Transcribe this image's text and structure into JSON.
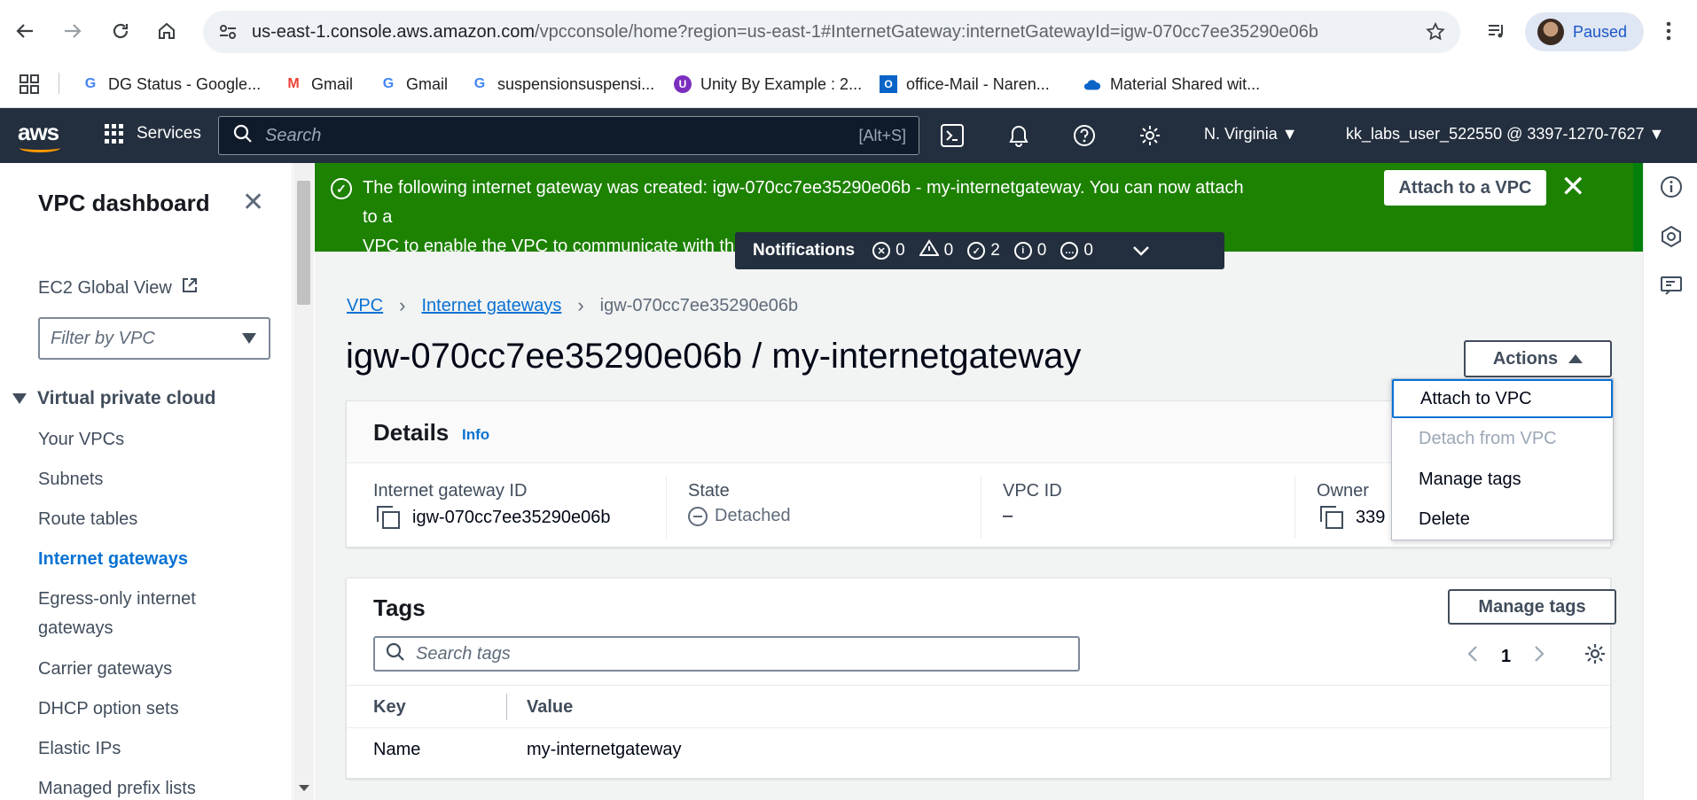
{
  "browser": {
    "url_host": "us-east-1.console.aws.amazon.com",
    "url_path": "/vpcconsole/home?region=us-east-1#InternetGateway:internetGatewayId=igw-070cc7ee35290e06b",
    "profile_status": "Paused"
  },
  "bookmarks": [
    {
      "label": "DG Status - Google...",
      "icon": "google-icon"
    },
    {
      "label": "Gmail",
      "icon": "gmail-icon"
    },
    {
      "label": "Gmail",
      "icon": "google-icon"
    },
    {
      "label": "suspensionsuspensi...",
      "icon": "google-icon"
    },
    {
      "label": "Unity By Example : 2...",
      "icon": "unity-icon"
    },
    {
      "label": "office-Mail - Naren...",
      "icon": "outlook-icon"
    },
    {
      "label": "Material Shared wit...",
      "icon": "onedrive-icon"
    }
  ],
  "aws_nav": {
    "logo": "aws",
    "services": "Services",
    "search_placeholder": "Search",
    "search_shortcut": "[Alt+S]",
    "region": "N. Virginia",
    "account": "kk_labs_user_522550 @ 3397-1270-7627"
  },
  "sidebar": {
    "title": "VPC dashboard",
    "ec2_global": "EC2 Global View",
    "filter_placeholder": "Filter by VPC",
    "section": "Virtual private cloud",
    "items": [
      {
        "label": "Your VPCs",
        "active": false
      },
      {
        "label": "Subnets",
        "active": false
      },
      {
        "label": "Route tables",
        "active": false
      },
      {
        "label": "Internet gateways",
        "active": true
      },
      {
        "label": "Egress-only internet",
        "active": false
      },
      {
        "label": "gateways",
        "active": false
      },
      {
        "label": "Carrier gateways",
        "active": false
      },
      {
        "label": "DHCP option sets",
        "active": false
      },
      {
        "label": "Elastic IPs",
        "active": false
      },
      {
        "label": "Managed prefix lists",
        "active": false
      }
    ]
  },
  "flash": {
    "line1": "The following internet gateway was created: igw-070cc7ee35290e06b - my-internetgateway. You can now attach to a",
    "line2": "VPC to enable the VPC to communicate with the internet.",
    "button": "Attach to a VPC",
    "color": "#1d8102"
  },
  "notifications": {
    "label": "Notifications",
    "errors": "0",
    "warnings": "0",
    "success": "2",
    "info": "0",
    "in_progress": "0"
  },
  "breadcrumb": {
    "vpc": "VPC",
    "igw": "Internet gateways",
    "current": "igw-070cc7ee35290e06b"
  },
  "page_title": "igw-070cc7ee35290e06b / my-internetgateway",
  "actions": {
    "label": "Actions",
    "menu": [
      "Attach to VPC",
      "Detach from VPC",
      "Manage tags",
      "Delete"
    ]
  },
  "details": {
    "title": "Details",
    "info": "Info",
    "igw_id_label": "Internet gateway ID",
    "igw_id": "igw-070cc7ee35290e06b",
    "state_label": "State",
    "state": "Detached",
    "vpc_id_label": "VPC ID",
    "vpc_id": "–",
    "owner_label": "Owner",
    "owner": "339"
  },
  "tags": {
    "title": "Tags",
    "manage": "Manage tags",
    "search_placeholder": "Search tags",
    "page": "1",
    "columns": [
      "Key",
      "Value"
    ],
    "rows": [
      {
        "key": "Name",
        "value": "my-internetgateway"
      }
    ]
  }
}
